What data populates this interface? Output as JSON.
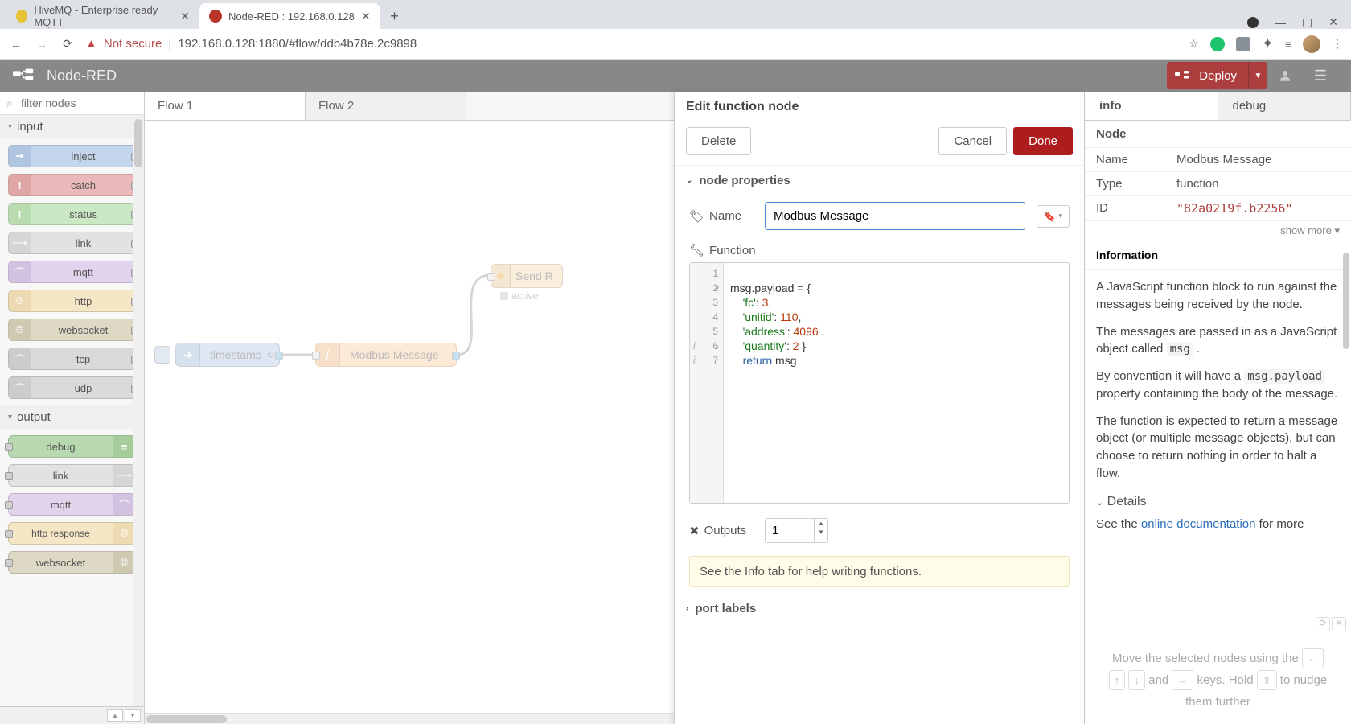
{
  "browser": {
    "tabs": [
      {
        "title": "HiveMQ - Enterprise ready MQTT",
        "favicon": "#e8c434"
      },
      {
        "title": "Node-RED : 192.168.0.128",
        "favicon": "#b8352a"
      }
    ],
    "not_secure": "Not secure",
    "url": "192.168.0.128:1880/#flow/ddb4b78e.2c9898"
  },
  "header": {
    "title": "Node-RED",
    "deploy": "Deploy"
  },
  "palette": {
    "search_placeholder": "filter nodes",
    "cat_input": "input",
    "cat_output": "output",
    "input_nodes": [
      "inject",
      "catch",
      "status",
      "link",
      "mqtt",
      "http",
      "websocket",
      "tcp",
      "udp"
    ],
    "output_nodes": [
      "debug",
      "link",
      "mqtt",
      "http response",
      "websocket"
    ]
  },
  "workspace": {
    "tabs": [
      "Flow 1",
      "Flow 2"
    ],
    "nodes": {
      "timestamp": "timestamp",
      "modbus": "Modbus Message",
      "send": "Send R",
      "active": "active"
    }
  },
  "tray": {
    "title": "Edit function node",
    "delete": "Delete",
    "cancel": "Cancel",
    "done": "Done",
    "node_properties": "node properties",
    "name_label": "Name",
    "name_value": "Modbus Message",
    "function_label": "Function",
    "code": {
      "l1": "",
      "l2a": "msg.payload ",
      "l2b": "=",
      "l2c": " {",
      "l3a": "'fc'",
      "l3b": ": ",
      "l3c": "3",
      "l3d": ",",
      "l4a": "'unitid'",
      "l4b": ": ",
      "l4c": "110",
      "l4d": ",",
      "l5a": "'address'",
      "l5b": ": ",
      "l5c": "4096",
      "l5d": " ,",
      "l6a": "'quantity'",
      "l6b": ": ",
      "l6c": "2",
      "l6d": " }",
      "l7a": "return",
      "l7b": " msg"
    },
    "outputs_label": "Outputs",
    "outputs_value": "1",
    "hint": "See the Info tab for help writing functions.",
    "port_labels": "port labels"
  },
  "sidebar": {
    "tabs": {
      "info": "info",
      "debug": "debug"
    },
    "section_node": "Node",
    "props": {
      "name_k": "Name",
      "name_v": "Modbus Message",
      "type_k": "Type",
      "type_v": "function",
      "id_k": "ID",
      "id_v": "\"82a0219f.b2256\""
    },
    "show_more": "show more ▾",
    "info_hdr": "Information",
    "info_p1": "A JavaScript function block to run against the messages being received by the node.",
    "info_p2a": "The messages are passed in as a JavaScript object called ",
    "info_p2b": "msg",
    "info_p2c": " .",
    "info_p3a": "By convention it will have a ",
    "info_p3b": "msg.payload",
    "info_p3c": " property containing the body of the message.",
    "info_p4": "The function is expected to return a message object (or multiple message objects), but can choose to return nothing in order to halt a flow.",
    "details": "Details",
    "see_the": "See the ",
    "online_doc": "online documentation",
    "for_more": " for more",
    "hint1": "Move the selected nodes using the ",
    "hint2": " and ",
    "hint3": " keys. Hold ",
    "hint4": " to nudge them further"
  }
}
